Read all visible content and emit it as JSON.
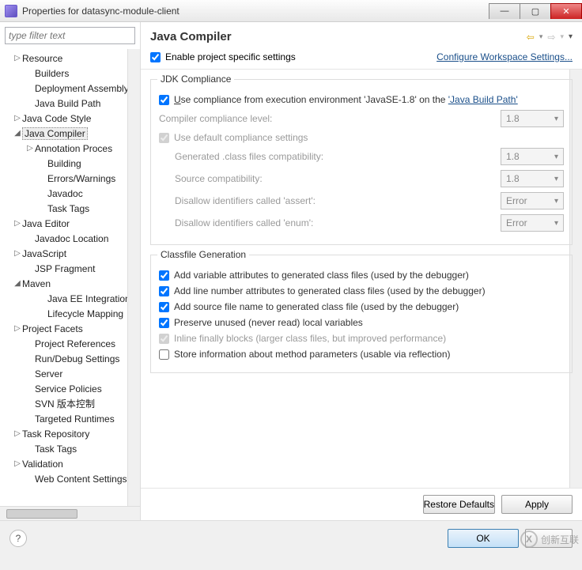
{
  "window": {
    "title": "Properties for datasync-module-client",
    "min": "—",
    "max": "▢",
    "close": "✕"
  },
  "filter": {
    "placeholder": "type filter text"
  },
  "tree": [
    {
      "lbl": "Resource",
      "ind": 1,
      "tw": "▷"
    },
    {
      "lbl": "Builders",
      "ind": 2,
      "tw": ""
    },
    {
      "lbl": "Deployment Assembly",
      "ind": 2,
      "tw": ""
    },
    {
      "lbl": "Java Build Path",
      "ind": 2,
      "tw": ""
    },
    {
      "lbl": "Java Code Style",
      "ind": 1,
      "tw": "▷"
    },
    {
      "lbl": "Java Compiler",
      "ind": 1,
      "tw": "◢",
      "sel": true
    },
    {
      "lbl": "Annotation Proces",
      "ind": 2,
      "tw": "▷"
    },
    {
      "lbl": "Building",
      "ind": 3,
      "tw": ""
    },
    {
      "lbl": "Errors/Warnings",
      "ind": 3,
      "tw": ""
    },
    {
      "lbl": "Javadoc",
      "ind": 3,
      "tw": ""
    },
    {
      "lbl": "Task Tags",
      "ind": 3,
      "tw": ""
    },
    {
      "lbl": "Java Editor",
      "ind": 1,
      "tw": "▷"
    },
    {
      "lbl": "Javadoc Location",
      "ind": 2,
      "tw": ""
    },
    {
      "lbl": "JavaScript",
      "ind": 1,
      "tw": "▷"
    },
    {
      "lbl": "JSP Fragment",
      "ind": 2,
      "tw": ""
    },
    {
      "lbl": "Maven",
      "ind": 1,
      "tw": "◢"
    },
    {
      "lbl": "Java EE Integration",
      "ind": 3,
      "tw": ""
    },
    {
      "lbl": "Lifecycle Mapping",
      "ind": 3,
      "tw": ""
    },
    {
      "lbl": "Project Facets",
      "ind": 1,
      "tw": "▷"
    },
    {
      "lbl": "Project References",
      "ind": 2,
      "tw": ""
    },
    {
      "lbl": "Run/Debug Settings",
      "ind": 2,
      "tw": ""
    },
    {
      "lbl": "Server",
      "ind": 2,
      "tw": ""
    },
    {
      "lbl": "Service Policies",
      "ind": 2,
      "tw": ""
    },
    {
      "lbl": "SVN 版本控制",
      "ind": 2,
      "tw": ""
    },
    {
      "lbl": "Targeted Runtimes",
      "ind": 2,
      "tw": ""
    },
    {
      "lbl": "Task Repository",
      "ind": 1,
      "tw": "▷"
    },
    {
      "lbl": "Task Tags",
      "ind": 2,
      "tw": ""
    },
    {
      "lbl": "Validation",
      "ind": 1,
      "tw": "▷"
    },
    {
      "lbl": "Web Content Settings",
      "ind": 2,
      "tw": ""
    }
  ],
  "panel": {
    "heading": "Java Compiler",
    "enable_label": "Enable project specific settings",
    "configure_link": "Configure Workspace Settings..."
  },
  "jdk": {
    "title": "JDK Compliance",
    "use_exec_pre": "Use compliance from execution environment 'JavaSE-1.8' on the ",
    "use_exec_link": "'Java Build Path'",
    "level_label": "Compiler compliance level:",
    "level_value": "1.8",
    "default_label": "Use default compliance settings",
    "gen_label": "Generated .class files compatibility:",
    "gen_value": "1.8",
    "src_label": "Source compatibility:",
    "src_value": "1.8",
    "assert_label": "Disallow identifiers called 'assert':",
    "assert_value": "Error",
    "enum_label": "Disallow identifiers called 'enum':",
    "enum_value": "Error"
  },
  "classfile": {
    "title": "Classfile Generation",
    "c1": "Add variable attributes to generated class files (used by the debugger)",
    "c2": "Add line number attributes to generated class files (used by the debugger)",
    "c3": "Add source file name to generated class file (used by the debugger)",
    "c4": "Preserve unused (never read) local variables",
    "c5": "Inline finally blocks (larger class files, but improved performance)",
    "c6": "Store information about method parameters (usable via reflection)"
  },
  "buttons": {
    "restore": "Restore Defaults",
    "apply": "Apply",
    "ok": "OK",
    "help": "?"
  },
  "watermark": {
    "logo": "X",
    "text": "创新互联"
  }
}
